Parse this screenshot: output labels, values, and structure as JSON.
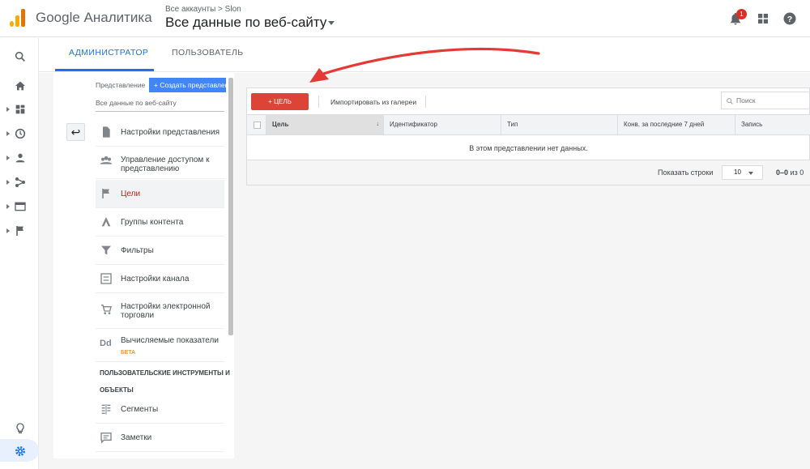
{
  "header": {
    "product_name": "Google Аналитика",
    "breadcrumb": "Все аккаунты > Slon",
    "view_title": "Все данные по веб-сайту",
    "notification_count": "1"
  },
  "tabs": [
    {
      "label": "АДМИНИСТРАТОР",
      "active": true
    },
    {
      "label": "ПОЛЬЗОВАТЕЛЬ",
      "active": false
    }
  ],
  "leftnav": {
    "items": [
      "search-icon",
      "home-icon",
      "customization-icon",
      "realtime-icon",
      "audience-icon",
      "acquisition-icon",
      "behavior-icon",
      "conversions-icon"
    ],
    "bottom": [
      "discover-icon",
      "admin-gear-icon"
    ]
  },
  "view_panel": {
    "label": "Представление",
    "create_button": "+ Создать представление",
    "selected_view": "Все данные по веб-сайту",
    "menu": [
      {
        "label": "Настройки представления",
        "icon": "document-icon"
      },
      {
        "label": "Управление доступом к представлению",
        "icon": "people-icon"
      },
      {
        "label": "Цели",
        "icon": "flag-icon",
        "selected": true
      },
      {
        "label": "Группы контента",
        "icon": "content-group-icon"
      },
      {
        "label": "Фильтры",
        "icon": "filter-icon"
      },
      {
        "label": "Настройки канала",
        "icon": "channel-icon"
      },
      {
        "label": "Настройки электронной торговли",
        "icon": "cart-icon"
      },
      {
        "label": "Вычисляемые показатели",
        "icon": "dd-icon",
        "badge": "БЕТА"
      }
    ],
    "section1": "ПОЛЬЗОВАТЕЛЬСКИЕ ИНСТРУМЕНТЫ И",
    "section2": "ОБЪЕКТЫ",
    "menu2": [
      {
        "label": "Сегменты",
        "icon": "segments-icon"
      },
      {
        "label": "Заметки",
        "icon": "notes-icon"
      }
    ]
  },
  "goals": {
    "new_goal_button": "+ ЦЕЛЬ",
    "import_link": "Импортировать из галереи",
    "search_placeholder": "Поиск",
    "columns": [
      "Цель",
      "Идентификатор",
      "Тип",
      "Конв. за последние 7 дней",
      "Запись"
    ],
    "empty_message": "В этом представлении нет данных.",
    "rows_label": "Показать строки",
    "rows_value": "10",
    "range": "0–0",
    "range_of": "из 0"
  },
  "colors": {
    "accent": "#1a73e8",
    "goal_button": "#db4437",
    "annotation_arrow": "#e53935"
  }
}
